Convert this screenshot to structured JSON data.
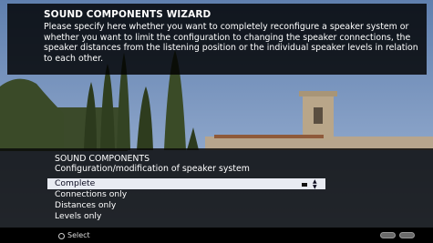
{
  "wizard": {
    "title": "SOUND COMPONENTS WIZARD",
    "text": "Please specify here whether you want to completely reconfigure a speaker system or whether you want to limit the configuration to changing the speaker connections, the speaker distances from the listening position or the individual speaker levels in relation to each other."
  },
  "panel": {
    "title": "SOUND COMPONENTS",
    "subtitle": "Configuration/modification of speaker system",
    "items": [
      {
        "label": "Complete"
      },
      {
        "label": "Connections only"
      },
      {
        "label": "Distances only"
      },
      {
        "label": "Levels only"
      }
    ],
    "selected_index": 0
  },
  "footer": {
    "select_label": "Select",
    "buttons": [
      "back-button",
      "exit-button"
    ]
  },
  "colors": {
    "highlight": "#e8ebf2",
    "overlay": "#000000"
  }
}
